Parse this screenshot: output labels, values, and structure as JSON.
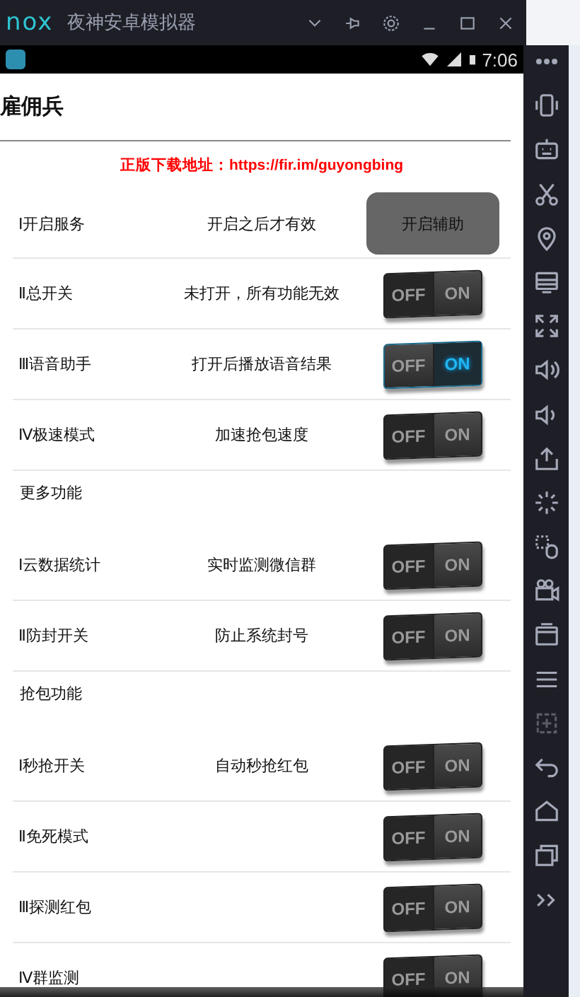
{
  "window": {
    "logo": "nox",
    "title": "夜神安卓模拟器"
  },
  "status_bar": {
    "time": "7:06"
  },
  "app": {
    "title": "雇佣兵",
    "link": "正版下载地址：https://fir.im/guyongbing",
    "items": [
      {
        "kind": "row",
        "label": "Ⅰ开启服务",
        "description": "开启之后才有效",
        "control": {
          "kind": "button",
          "text": "开启辅助"
        }
      },
      {
        "kind": "row",
        "label": "Ⅱ总开关",
        "description": "未打开，所有功能无效",
        "control": {
          "kind": "toggle",
          "off_text": "OFF",
          "on_text": "ON",
          "on": false
        }
      },
      {
        "kind": "row",
        "label": "Ⅲ语音助手",
        "description": "打开后播放语音结果",
        "control": {
          "kind": "toggle",
          "off_text": "OFF",
          "on_text": "ON",
          "on": true
        }
      },
      {
        "kind": "row",
        "label": "Ⅳ极速模式",
        "description": "加速抢包速度",
        "control": {
          "kind": "toggle",
          "off_text": "OFF",
          "on_text": "ON",
          "on": false
        }
      },
      {
        "kind": "header",
        "text": "更多功能"
      },
      {
        "kind": "row",
        "label": "Ⅰ云数据统计",
        "description": "实时监测微信群",
        "control": {
          "kind": "toggle",
          "off_text": "OFF",
          "on_text": "ON",
          "on": false
        }
      },
      {
        "kind": "row",
        "label": "Ⅱ防封开关",
        "description": "防止系统封号",
        "control": {
          "kind": "toggle",
          "off_text": "OFF",
          "on_text": "ON",
          "on": false
        }
      },
      {
        "kind": "header",
        "text": "抢包功能"
      },
      {
        "kind": "row",
        "label": "Ⅰ秒抢开关",
        "description": "自动秒抢红包",
        "control": {
          "kind": "toggle",
          "off_text": "OFF",
          "on_text": "ON",
          "on": false
        }
      },
      {
        "kind": "row",
        "label": "Ⅱ免死模式",
        "control": {
          "kind": "toggle",
          "off_text": "OFF",
          "on_text": "ON",
          "on": false
        }
      },
      {
        "kind": "row",
        "label": "Ⅲ探测红包",
        "control": {
          "kind": "toggle",
          "off_text": "OFF",
          "on_text": "ON",
          "on": false
        }
      },
      {
        "kind": "row",
        "label": "Ⅳ群监测",
        "control": {
          "kind": "toggle",
          "off_text": "OFF",
          "on_text": "ON",
          "on": false
        }
      }
    ]
  }
}
